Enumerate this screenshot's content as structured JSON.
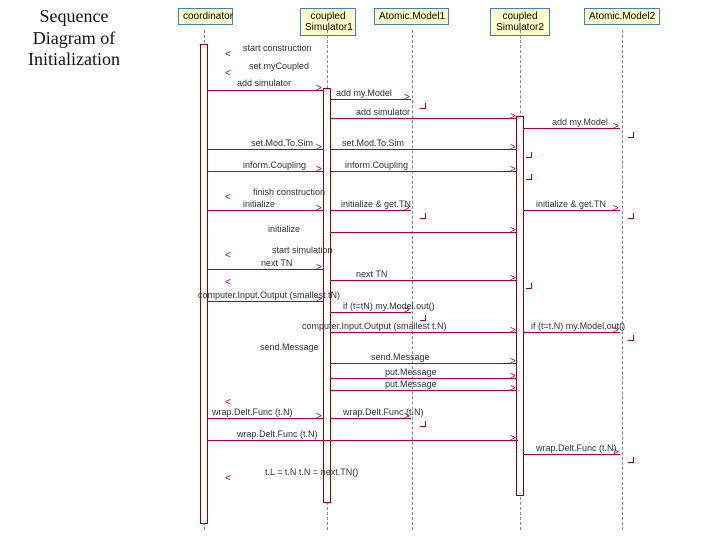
{
  "title": "Sequence Diagram of Initialization",
  "participants": {
    "coordinator": "coordinator",
    "coupledSim1": "coupled Simulator1",
    "atomicModel1": "Atomic.Model1",
    "coupledSim2": "coupled Simulator2",
    "atomicModel2": "Atomic.Model2"
  },
  "messages": {
    "startConstruction": "start construction",
    "setMyCoupled": "set myCoupled",
    "addSimulator": "add simulator",
    "addMyModel1": "add my.Model",
    "addSimulator2": "add simulator",
    "addMyModel2": "add my.Model",
    "setModToSim1": "set.Mod.To.Sim",
    "setModToSim2": "set.Mod.To.Sim",
    "informCoupling1": "inform.Coupling",
    "informCoupling2": "inform.Coupling",
    "finishConstruction": "finish construction",
    "initialize": "initialize",
    "initializeGetTN1": "initialize & get.TN",
    "initializeGetTN2": "initialize & get.TN",
    "initialize2": "initialize",
    "startSimulation": "start simulation",
    "nextTN1": "next TN",
    "nextTN2": "next TN",
    "computerIO1": "computer.Input.Output (smallest tN)",
    "ifTtNout1": "if (t=tN) my.Model.out()",
    "computerIO2": "computer.Input.Output (smallest t.N)",
    "ifTtNout2": "if (t=t.N) my.Model.out()",
    "sendMessage1": "send.Message",
    "sendMessage2": "send.Message",
    "putMessage1": "put.Message",
    "putMessage2": "put.Message",
    "wrapDeltFunc1": "wrap.Delt.Func (t.N)",
    "wrapDeltFunc2": "wrap.Delt.Func (t.N)",
    "wrapDeltFunc3": "wrap.Delt.Func (t.N)",
    "wrapDeltFunc4": "wrap.Delt.Func (t.N)",
    "tLtN": "t.L = t.N  t.N = next.TN()"
  },
  "geometry": {
    "lanes": {
      "coordinator": 204,
      "coupledSim1": 327,
      "atomicModel1": 412,
      "coupledSim2": 520,
      "atomicModel2": 622
    }
  }
}
